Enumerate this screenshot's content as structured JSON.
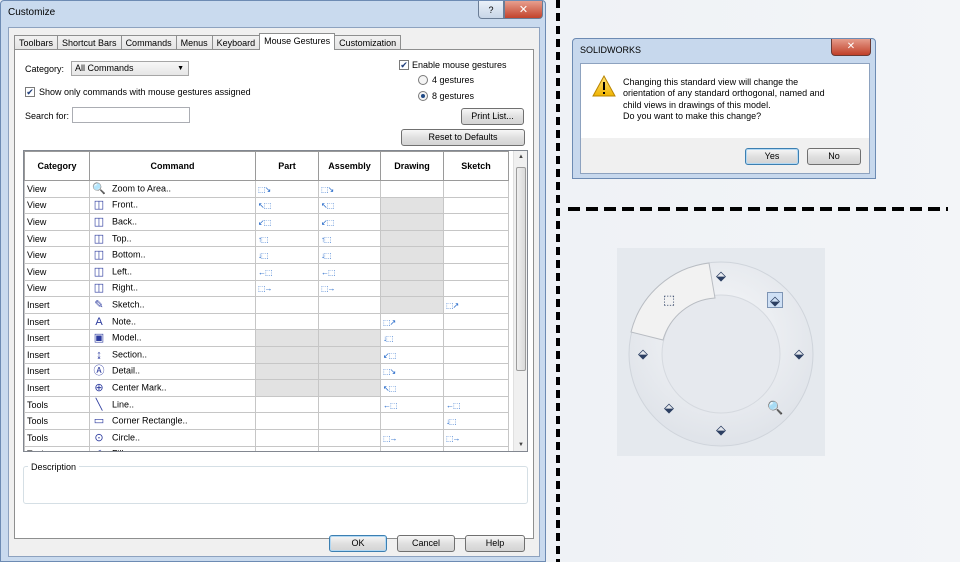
{
  "customize": {
    "title": "Customize",
    "help_btn": "?",
    "close_btn": "✕",
    "tabs": [
      "Toolbars",
      "Shortcut Bars",
      "Commands",
      "Menus",
      "Keyboard",
      "Mouse Gestures",
      "Customization"
    ],
    "active_tab": "Mouse Gestures",
    "category_label": "Category:",
    "category_value": "All Commands",
    "show_only_label": "Show only commands with mouse gestures assigned",
    "show_only_checked": true,
    "search_label": "Search for:",
    "search_value": "",
    "enable_label": "Enable mouse gestures",
    "enable_checked": true,
    "gestures_4_label": "4 gestures",
    "gestures_8_label": "8 gestures",
    "selected_gestures": "8 gestures",
    "print_list": "Print List...",
    "reset_defaults": "Reset to Defaults",
    "columns": [
      "Category",
      "Command",
      "Part",
      "Assembly",
      "Drawing",
      "Sketch"
    ],
    "rows": [
      {
        "category": "View",
        "icon": "zoom-to-area-icon",
        "glyph": "🔍",
        "command": "Zoom to Area..",
        "part": "⬚↘",
        "assembly": "⬚↘",
        "drawing": "",
        "sketch": "",
        "gray": []
      },
      {
        "category": "View",
        "icon": "front-view-icon",
        "glyph": "◫",
        "command": "Front..",
        "part": "↖⬚",
        "assembly": "↖⬚",
        "drawing": "",
        "sketch": "",
        "gray": [
          "drawing"
        ]
      },
      {
        "category": "View",
        "icon": "back-view-icon",
        "glyph": "◫",
        "command": "Back..",
        "part": "↙⬚",
        "assembly": "↙⬚",
        "drawing": "",
        "sketch": "",
        "gray": [
          "drawing"
        ]
      },
      {
        "category": "View",
        "icon": "top-view-icon",
        "glyph": "◫",
        "command": "Top..",
        "part": "↑⬚",
        "assembly": "↑⬚",
        "drawing": "",
        "sketch": "",
        "gray": [
          "drawing"
        ]
      },
      {
        "category": "View",
        "icon": "bottom-view-icon",
        "glyph": "◫",
        "command": "Bottom..",
        "part": "↓⬚",
        "assembly": "↓⬚",
        "drawing": "",
        "sketch": "",
        "gray": [
          "drawing"
        ]
      },
      {
        "category": "View",
        "icon": "left-view-icon",
        "glyph": "◫",
        "command": "Left..",
        "part": "←⬚",
        "assembly": "←⬚",
        "drawing": "",
        "sketch": "",
        "gray": [
          "drawing"
        ]
      },
      {
        "category": "View",
        "icon": "right-view-icon",
        "glyph": "◫",
        "command": "Right..",
        "part": "⬚→",
        "assembly": "⬚→",
        "drawing": "",
        "sketch": "",
        "gray": [
          "drawing"
        ]
      },
      {
        "category": "Insert",
        "icon": "sketch-icon",
        "glyph": "✎",
        "command": "Sketch..",
        "part": "",
        "assembly": "",
        "drawing": "",
        "sketch": "⬚↗",
        "gray": [
          "drawing"
        ]
      },
      {
        "category": "Insert",
        "icon": "note-icon",
        "glyph": "A",
        "command": "Note..",
        "part": "",
        "assembly": "",
        "drawing": "⬚↗",
        "sketch": "",
        "gray": []
      },
      {
        "category": "Insert",
        "icon": "model-icon",
        "glyph": "▣",
        "command": "Model..",
        "part": "",
        "assembly": "",
        "drawing": "↓⬚",
        "sketch": "",
        "gray": [
          "part",
          "assembly"
        ]
      },
      {
        "category": "Insert",
        "icon": "section-icon",
        "glyph": "↨",
        "command": "Section..",
        "part": "",
        "assembly": "",
        "drawing": "↙⬚",
        "sketch": "",
        "gray": [
          "part",
          "assembly"
        ]
      },
      {
        "category": "Insert",
        "icon": "detail-icon",
        "glyph": "Ⓐ",
        "command": "Detail..",
        "part": "",
        "assembly": "",
        "drawing": "⬚↘",
        "sketch": "",
        "gray": [
          "part",
          "assembly"
        ]
      },
      {
        "category": "Insert",
        "icon": "center-mark-icon",
        "glyph": "⊕",
        "command": "Center Mark..",
        "part": "",
        "assembly": "",
        "drawing": "↖⬚",
        "sketch": "",
        "gray": [
          "part",
          "assembly"
        ]
      },
      {
        "category": "Tools",
        "icon": "line-icon",
        "glyph": "╲",
        "command": "Line..",
        "part": "",
        "assembly": "",
        "drawing": "←⬚",
        "sketch": "←⬚",
        "gray": []
      },
      {
        "category": "Tools",
        "icon": "corner-rectangle-icon",
        "glyph": "▭",
        "command": "Corner Rectangle..",
        "part": "",
        "assembly": "",
        "drawing": "",
        "sketch": "↓⬚",
        "gray": []
      },
      {
        "category": "Tools",
        "icon": "circle-icon",
        "glyph": "⊙",
        "command": "Circle..",
        "part": "",
        "assembly": "",
        "drawing": "⬚→",
        "sketch": "⬚→",
        "gray": []
      },
      {
        "category": "Tools",
        "icon": "fillet-icon",
        "glyph": "◜",
        "command": "Fill..",
        "part": "",
        "assembly": "",
        "drawing": "",
        "sketch": "⬚",
        "gray": []
      }
    ],
    "description_label": "Description",
    "ok": "OK",
    "cancel": "Cancel",
    "help": "Help"
  },
  "solidworks_dialog": {
    "title": "SOLIDWORKS",
    "close": "✕",
    "message_lines": [
      "Changing this standard view will change the",
      "orientation of any standard orthogonal, named and",
      "child views in drawings of this model.",
      "Do you want to make this change?"
    ],
    "yes": "Yes",
    "no": "No"
  },
  "gesture_wheel": {
    "items": [
      {
        "name": "wheel-top-icon",
        "glyph": "⬙"
      },
      {
        "name": "wheel-isometric-icon",
        "glyph": "⬚"
      },
      {
        "name": "wheel-right-icon",
        "glyph": "⬙"
      },
      {
        "name": "wheel-zoom-icon",
        "glyph": "🔍"
      },
      {
        "name": "wheel-bottom-icon",
        "glyph": "⬙"
      },
      {
        "name": "wheel-back-icon",
        "glyph": "⬙"
      },
      {
        "name": "wheel-left-icon",
        "glyph": "⬙"
      },
      {
        "name": "wheel-front-icon",
        "glyph": "⬙"
      }
    ]
  }
}
